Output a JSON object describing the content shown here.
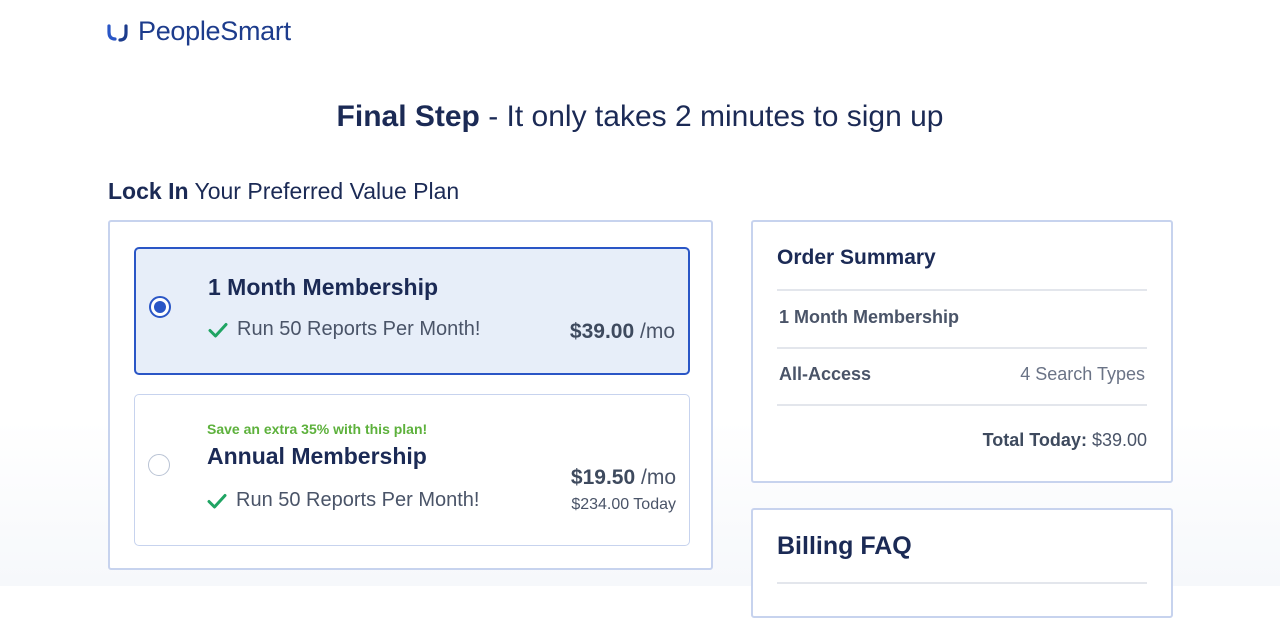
{
  "brand": {
    "name": "PeopleSmart",
    "accent": "#1d3c8c",
    "selected": "#2a56c6",
    "check": "#1fa463",
    "promo": "#5db13c"
  },
  "headline": {
    "strong": "Final Step",
    "rest": " - It only takes 2 minutes to sign up"
  },
  "section": {
    "strong": "Lock In",
    "rest": " Your Preferred Value Plan"
  },
  "plans": [
    {
      "name": "1 Month Membership",
      "feature": "Run 50 Reports Per Month!",
      "price": "$39.00",
      "per": " /mo",
      "selected": true
    },
    {
      "promo": "Save an extra 35% with this plan!",
      "name": "Annual Membership",
      "feature": "Run 50 Reports Per Month!",
      "price": "$19.50",
      "per": " /mo",
      "today": "$234.00 Today",
      "selected": false
    }
  ],
  "summary": {
    "title": "Order Summary",
    "plan": "1 Month Membership",
    "access_label": "All-Access",
    "access_value": "4 Search Types",
    "total_label": "Total Today:",
    "total_value": " $39.00"
  },
  "faq": {
    "title": "Billing FAQ"
  },
  "icons": {
    "logo": "peoplesmart-logo-icon",
    "check": "check-icon"
  }
}
